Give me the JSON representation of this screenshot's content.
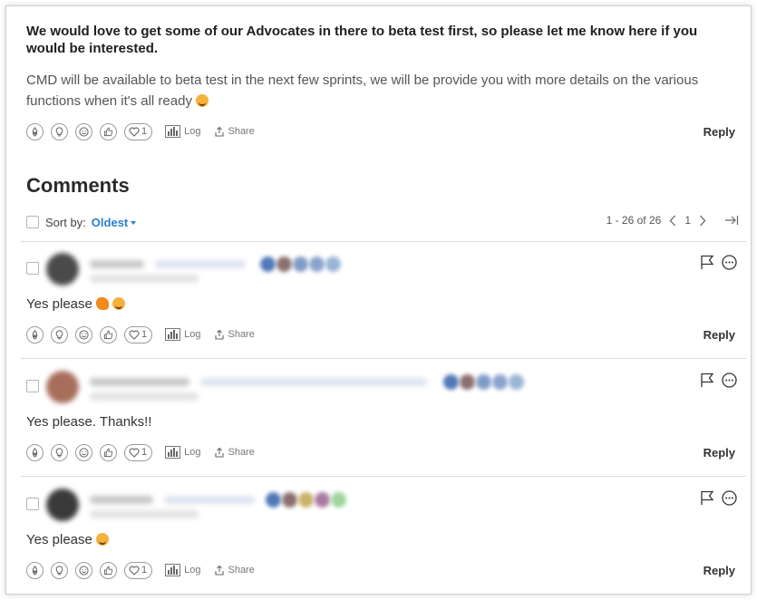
{
  "post": {
    "headline": "We would love to get some of our Advocates in there to beta test first, so please let me know here if you would be interested.",
    "body": "CMD will be available to beta test in the next few sprints, we will be provide you with more details on the various functions when it's all ready",
    "emoji": "smiling-face",
    "actions": {
      "heart_count": "1",
      "log_label": "Log",
      "share_label": "Share",
      "reply_label": "Reply"
    }
  },
  "comments_section": {
    "title": "Comments",
    "sort_label": "Sort by:",
    "sort_value": "Oldest",
    "pagination": {
      "range": "1 - 26 of 26",
      "page": "1"
    }
  },
  "comments": [
    {
      "text": "Yes please",
      "emojis": [
        "raised-hand",
        "grinning-face"
      ],
      "avatar_color": "#4a4a4a",
      "badge_colors": [
        "#4f79b8",
        "#8b6f6f",
        "#7f9cc7",
        "#8aa4cc",
        "#9ab3d6"
      ],
      "actions": {
        "heart_count": "1",
        "log_label": "Log",
        "share_label": "Share",
        "reply_label": "Reply"
      }
    },
    {
      "text": "Yes please. Thanks!!",
      "emojis": [],
      "avatar_color": "#a86e5c",
      "badge_colors": [
        "#4f79b8",
        "#8b6f6f",
        "#7f9cc7",
        "#8aa4cc",
        "#9ab3d6"
      ],
      "actions": {
        "heart_count": "1",
        "log_label": "Log",
        "share_label": "Share",
        "reply_label": "Reply"
      }
    },
    {
      "text": "Yes please",
      "emojis": [
        "grinning-face"
      ],
      "avatar_color": "#3a3a3a",
      "badge_colors": [
        "#4f79b8",
        "#8b6f6f",
        "#c9b36a",
        "#a87aa2",
        "#9fd49a"
      ],
      "actions": {
        "heart_count": "1",
        "log_label": "Log",
        "share_label": "Share",
        "reply_label": "Reply"
      }
    }
  ]
}
